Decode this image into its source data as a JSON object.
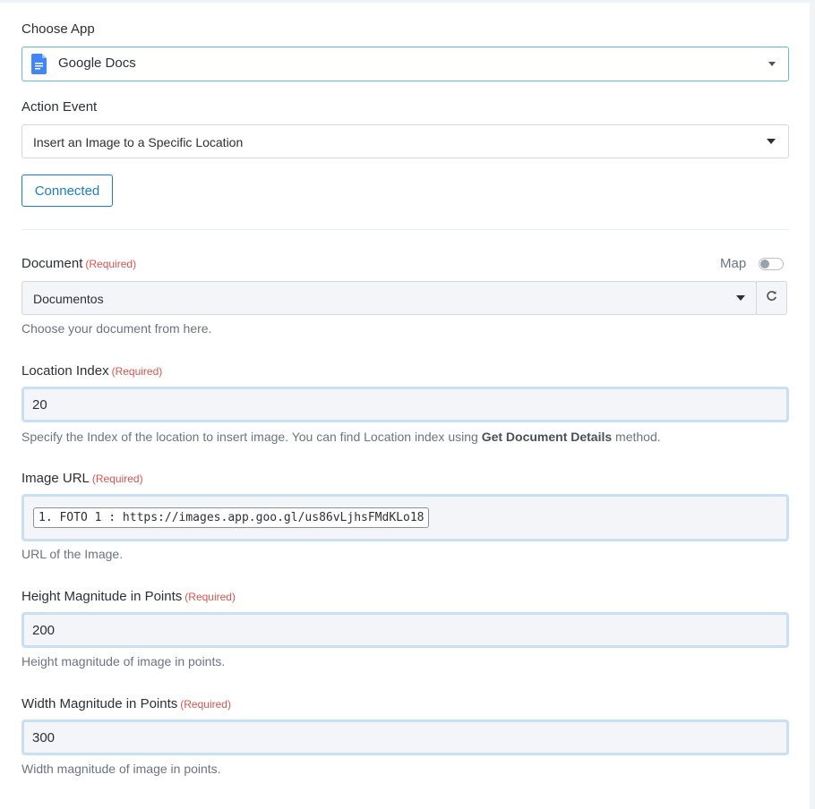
{
  "choose_app": {
    "label": "Choose App",
    "selected": "Google Docs",
    "icon": "google-docs-icon",
    "icon_color": "#4285f4"
  },
  "action_event": {
    "label": "Action Event",
    "selected": "Insert an Image to a Specific Location"
  },
  "connected_button": {
    "label": "Connected",
    "color": "#1a7fc1"
  },
  "document": {
    "label": "Document",
    "required": "(Required)",
    "map_label": "Map",
    "map_enabled": false,
    "selected": "Documentos",
    "help": "Choose your document from here."
  },
  "location_index": {
    "label": "Location Index",
    "required": "(Required)",
    "value": "20",
    "help_prefix": "Specify the Index of the location to insert image. You can find Location index using ",
    "help_bold": "Get Document Details",
    "help_suffix": " method."
  },
  "image_url": {
    "label": "Image URL",
    "required": "(Required)",
    "token": "1. FOTO 1 : https://images.app.goo.gl/us86vLjhsFMdKLo18",
    "help": "URL of the Image."
  },
  "height": {
    "label": "Height Magnitude in Points",
    "required": "(Required)",
    "value": "200",
    "help": "Height magnitude of image in points."
  },
  "width": {
    "label": "Width Magnitude in Points",
    "required": "(Required)",
    "value": "300",
    "help": "Width magnitude of image in points."
  }
}
